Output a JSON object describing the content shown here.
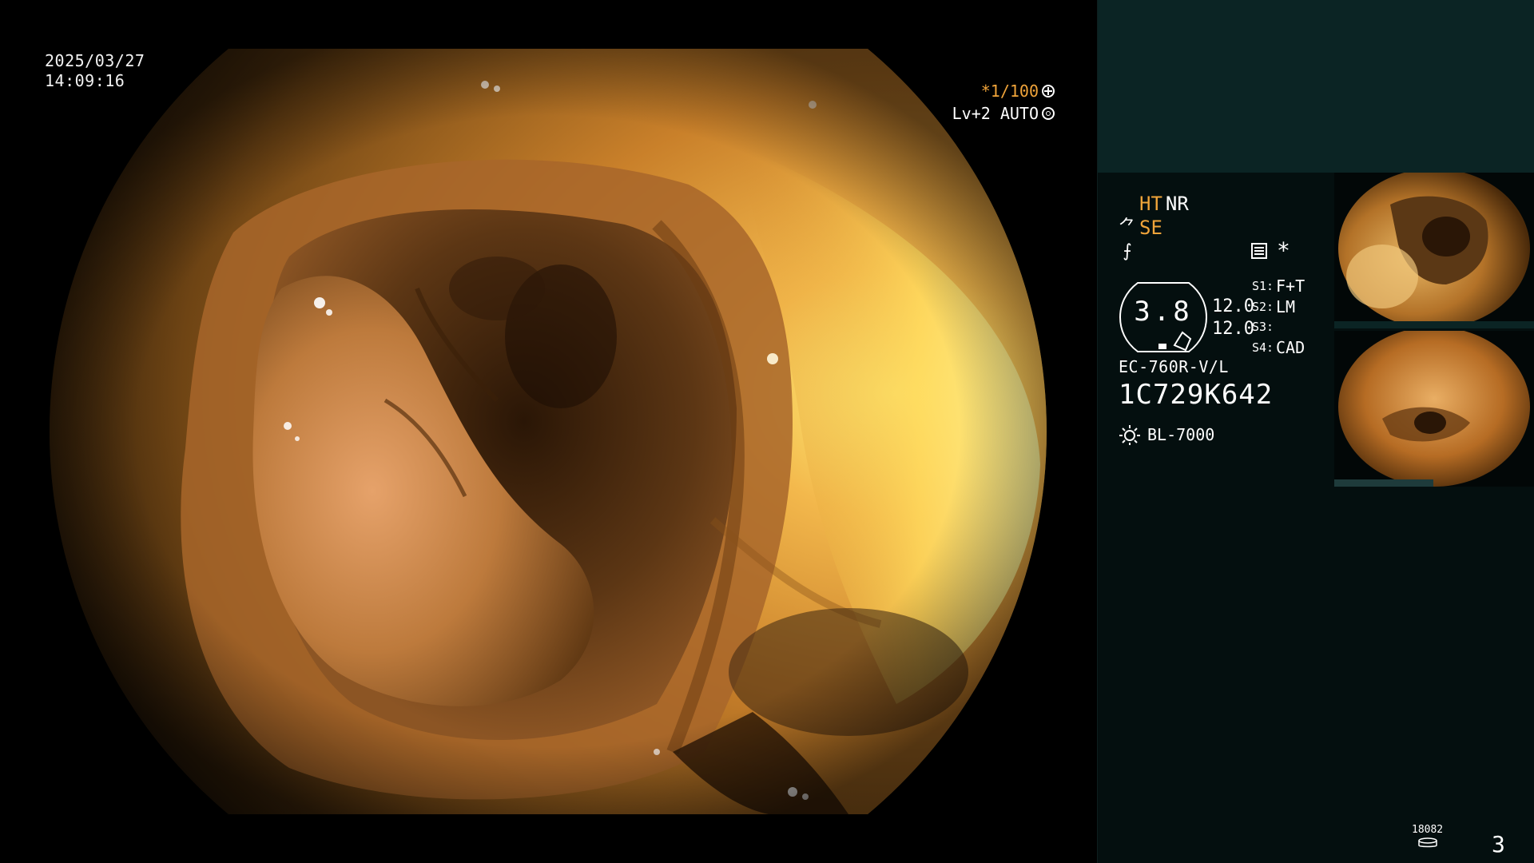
{
  "overlay": {
    "date": "2025/03/27",
    "time": "14:09:16",
    "shutter": "*1/100",
    "shutter_icon": "fan-icon",
    "iris": "Lv+2 AUTO",
    "iris_icon": "ring-icon"
  },
  "panel": {
    "mode": {
      "ht": "HT",
      "nr": "NR",
      "se_symbol": "⺈",
      "se": "SE",
      "sharp_symbol": "⨍"
    },
    "menu_icon": "menu-list-icon",
    "asterisk": "*",
    "gauge_value": "3.8",
    "scale_1": "12.0",
    "scale_2": "12.0",
    "settings": [
      {
        "key": "S1:",
        "value": "F+T"
      },
      {
        "key": "S2:",
        "value": "LM"
      },
      {
        "key": "S3:",
        "value": ""
      },
      {
        "key": "S4:",
        "value": "CAD"
      }
    ],
    "scope_model": "EC-760R-V/L",
    "serial": "1C729K642",
    "light_source": "BL-7000",
    "light_icon": "sun-icon",
    "storage_count": "18082",
    "storage_icon": "disk-icon",
    "image_count": "3"
  },
  "colors": {
    "accent": "#f0a43a",
    "panel_bg": "#040f0f",
    "panel_top": "#0b2424"
  }
}
